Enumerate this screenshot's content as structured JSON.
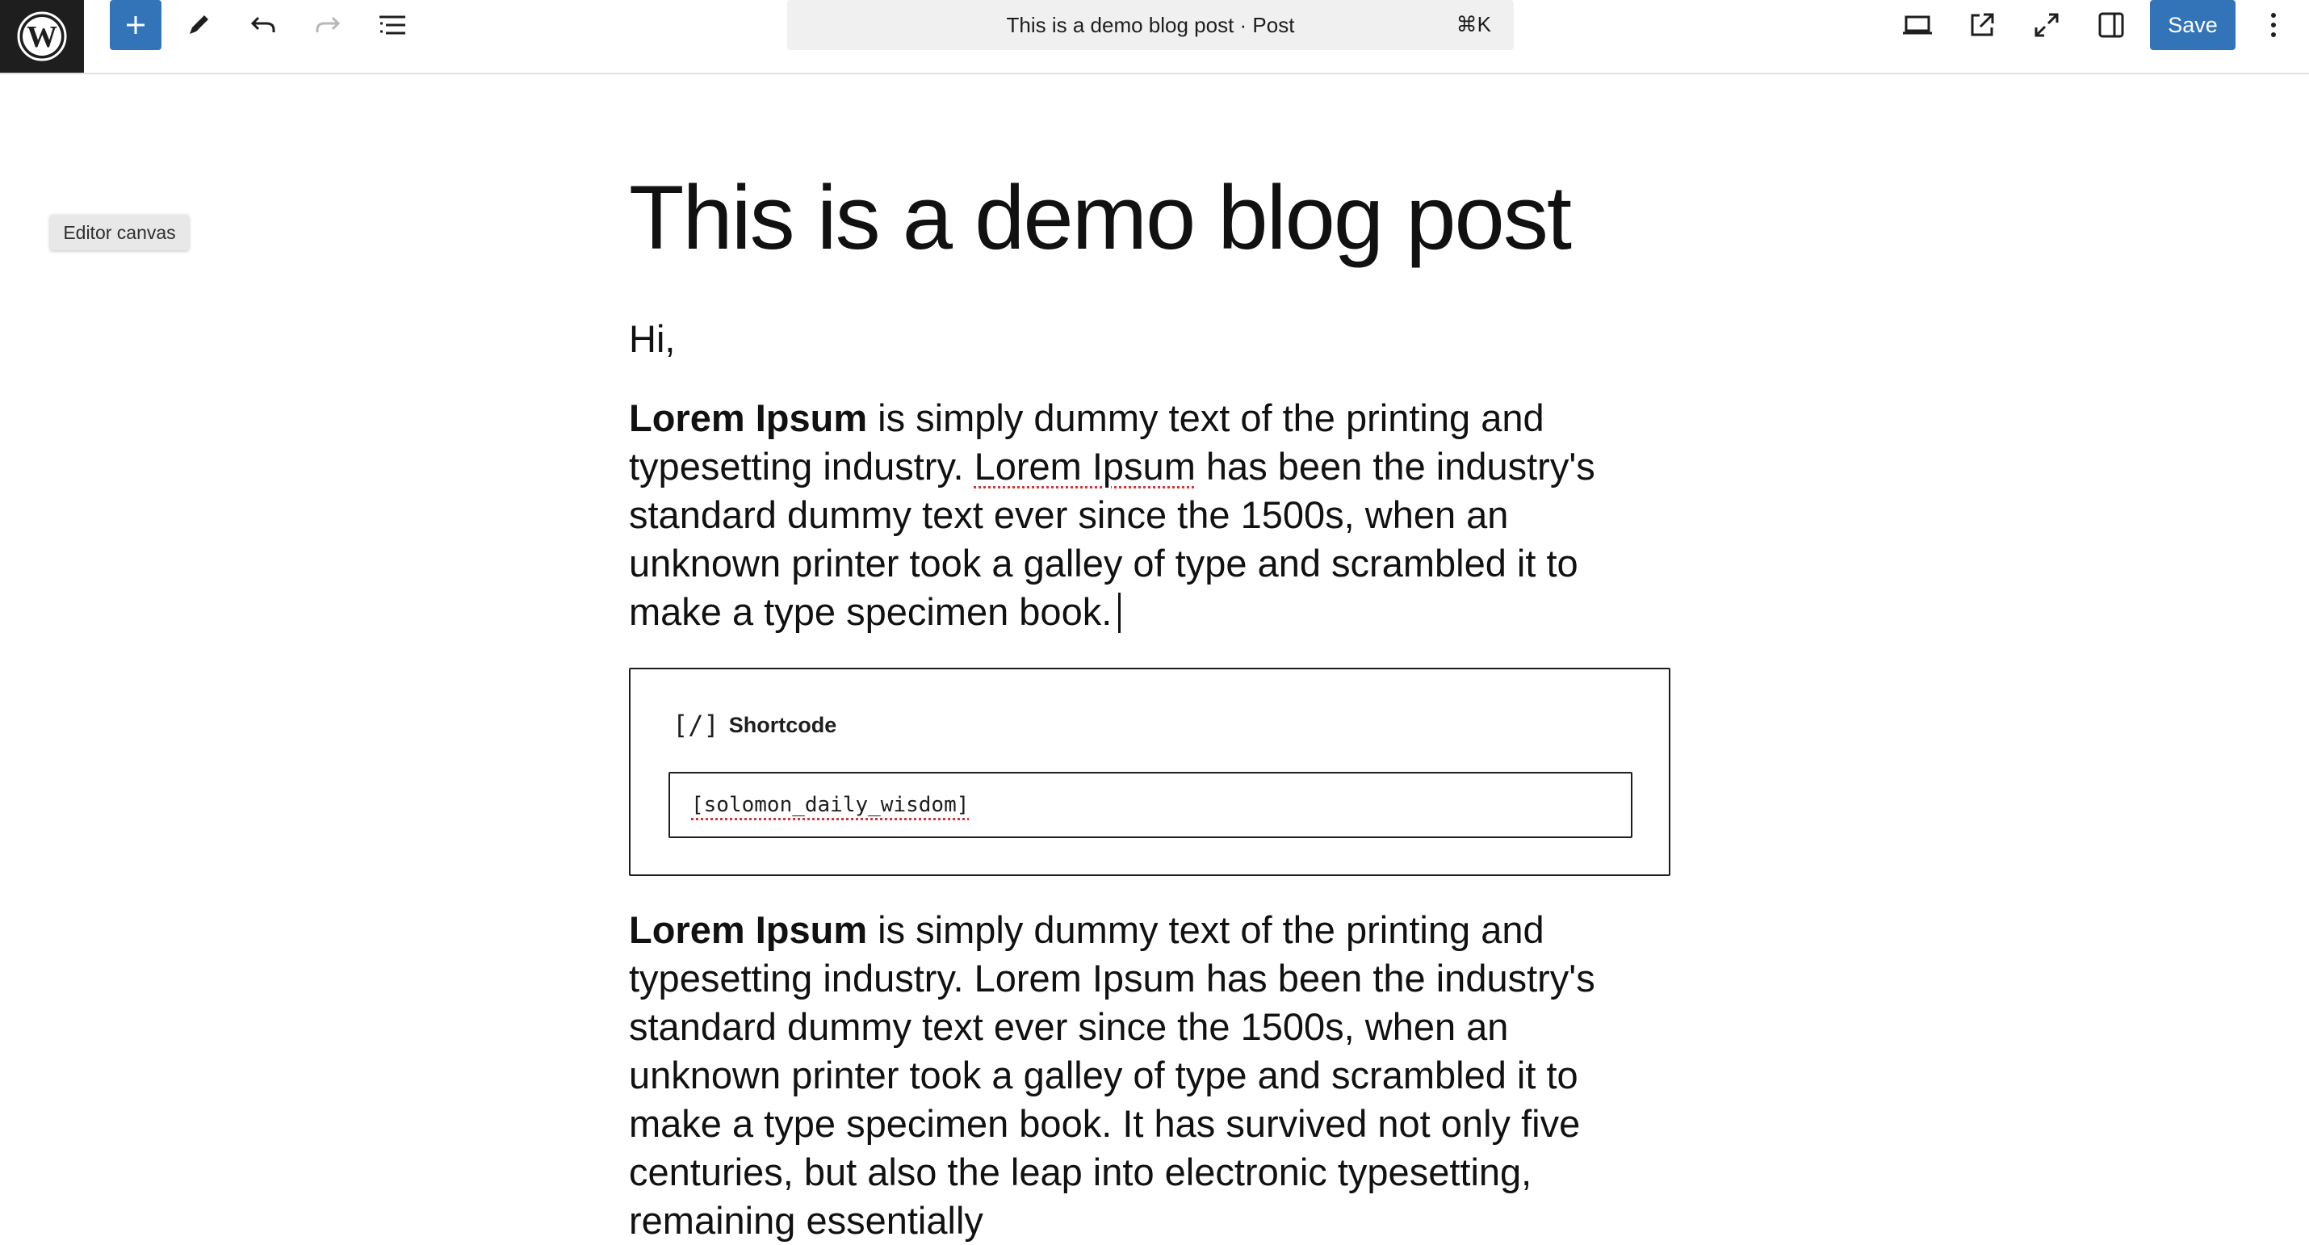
{
  "toolbar": {
    "logo_name": "wordpress-logo",
    "document_title": "This is a demo blog post · Post",
    "command_shortcut": "⌘K",
    "save_label": "Save",
    "accent_color": "#3374b8"
  },
  "tooltip": {
    "text": "Editor canvas"
  },
  "post": {
    "title": "This is a demo blog post",
    "greeting": "Hi,",
    "paragraph1": {
      "bold_lead": "Lorem Ipsum",
      "text_a": " is simply dummy text of the printing and typesetting industry. ",
      "flagged": "Lorem Ipsum",
      "text_b": " has been the industry's standard dummy text ever since the 1500s, when an unknown printer took a galley of type and scrambled it to make a type specimen book."
    },
    "shortcode": {
      "icon_text": "[/]",
      "label": "Shortcode",
      "value": "[solomon_daily_wisdom]"
    },
    "paragraph2": {
      "bold_lead": "Lorem Ipsum",
      "text": " is simply dummy text of the printing and typesetting industry. Lorem Ipsum has been the industry's standard dummy text ever since the 1500s, when an unknown printer took a galley of type and scrambled it to make a type specimen book. It has survived not only five centuries, but also the leap into electronic typesetting, remaining essentially"
    }
  }
}
